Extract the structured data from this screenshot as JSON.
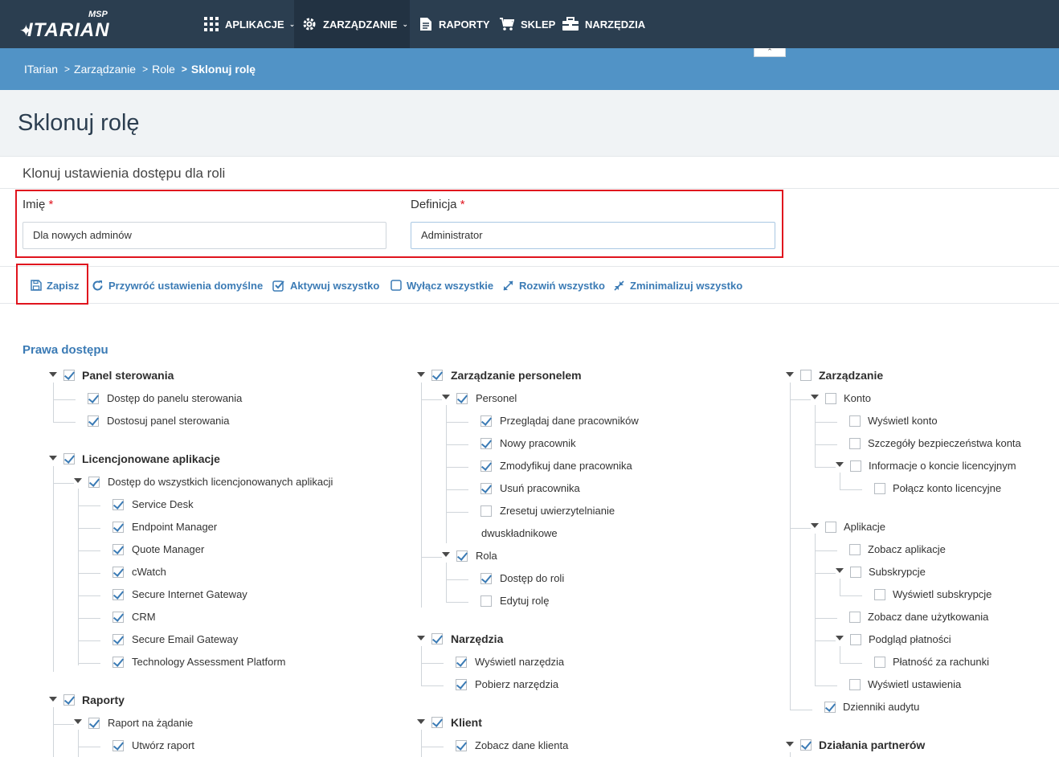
{
  "brand": {
    "name": "ITARIAN",
    "tag": "MSP"
  },
  "nav": {
    "items": [
      {
        "label": "APLIKACJE",
        "icon": "grid-icon",
        "has_dropdown": true,
        "active": false
      },
      {
        "label": "ZARZĄDZANIE",
        "icon": "gear-icon",
        "has_dropdown": true,
        "active": true
      },
      {
        "label": "RAPORTY",
        "icon": "report-icon",
        "has_dropdown": false,
        "active": false
      },
      {
        "label": "SKLEP",
        "icon": "cart-icon",
        "has_dropdown": false,
        "active": false
      },
      {
        "label": "NARZĘDZIA",
        "icon": "toolbox-icon",
        "has_dropdown": false,
        "active": false
      }
    ]
  },
  "breadcrumb": [
    "ITarian",
    "Zarządzanie",
    "Role",
    "Sklonuj rolę"
  ],
  "page_title": "Sklonuj rolę",
  "subtitle": "Klonuj ustawienia dostępu dla roli",
  "form": {
    "name_label": "Imię",
    "name_value": "Dla nowych adminów",
    "definition_label": "Definicja",
    "definition_value": "Administrator",
    "required_mark": "*"
  },
  "toolbar": {
    "save": "Zapisz",
    "restore": "Przywróć ustawienia domyślne",
    "activate_all": "Aktywuj wszystko",
    "deactivate_all": "Wyłącz wszystkie",
    "expand_all": "Rozwiń wszystko",
    "collapse_all": "Zminimalizuj wszystko"
  },
  "permissions": {
    "title": "Prawa dostępu",
    "col1": {
      "dashboard": {
        "label": "Panel sterowania",
        "checked": true,
        "children": [
          "Dostęp do panelu sterowania",
          "Dostosuj panel sterowania"
        ]
      },
      "licensed": {
        "label": "Licencjonowane aplikacje",
        "checked": true,
        "all": "Dostęp do wszystkich licencjonowanych aplikacji",
        "children": [
          "Service Desk",
          "Endpoint Manager",
          "Quote Manager",
          "cWatch",
          "Secure Internet Gateway",
          "CRM",
          "Secure Email Gateway",
          "Technology Assessment Platform"
        ]
      },
      "reports": {
        "label": "Raporty",
        "checked": true,
        "ondemand": "Raport na żądanie",
        "create": "Utwórz raport"
      }
    },
    "col2": {
      "staff": {
        "label": "Zarządzanie personelem",
        "checked": true,
        "personel": "Personel",
        "personel_children": [
          "Przeglądaj dane pracowników",
          "Nowy pracownik",
          "Zmodyfikuj dane pracownika",
          "Usuń pracownika",
          "Zresetuj uwierzytelnianie",
          "dwuskładnikowe"
        ],
        "role": "Rola",
        "role_children": [
          "Dostęp do roli",
          "Edytuj rolę"
        ]
      },
      "tools": {
        "label": "Narzędzia",
        "checked": true,
        "children": [
          "Wyświetl narzędzia",
          "Pobierz narzędzia"
        ]
      },
      "client": {
        "label": "Klient",
        "checked": true,
        "children": [
          "Zobacz dane klienta"
        ]
      }
    },
    "col3": {
      "management": {
        "label": "Zarządzanie",
        "checked": false,
        "account": "Konto",
        "account_children": [
          "Wyświetl konto",
          "Szczegóły bezpieczeństwa konta",
          "Informacje o koncie licencyjnym",
          "Połącz konto licencyjne"
        ],
        "apps": "Aplikacje",
        "apps_children": [
          "Zobacz aplikacje",
          "Subskrypcje",
          "Wyświetl subskrypcje",
          "Zobacz dane użytkowania",
          "Podgląd płatności",
          "Płatność za rachunki",
          "Wyświetl ustawienia"
        ],
        "audit": "Dzienniki audytu"
      },
      "partner": {
        "label": "Działania partnerów",
        "checked": true
      }
    }
  },
  "colors": {
    "nav_bg": "#2b3e50",
    "crumb_bg": "#5193c6",
    "accent": "#3b7bb5",
    "highlight": "#e0141e"
  }
}
